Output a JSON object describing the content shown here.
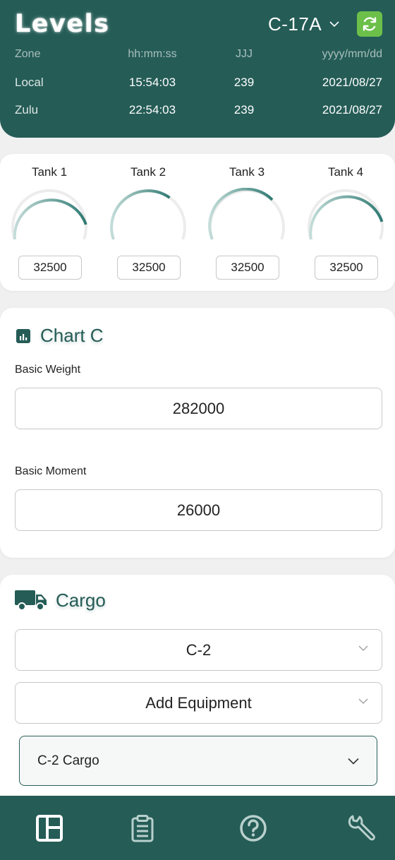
{
  "header": {
    "title": "Levels",
    "aircraft": "C-17A",
    "refresh_icon": "refresh-icon",
    "time_table": {
      "columns": [
        "Zone",
        "hh:mm:ss",
        "JJJ",
        "yyyy/mm/dd"
      ],
      "rows": [
        {
          "zone": "Local",
          "time": "15:54:03",
          "julian": "239",
          "date": "2021/08/27"
        },
        {
          "zone": "Zulu",
          "time": "22:54:03",
          "julian": "239",
          "date": "2021/08/27"
        }
      ]
    }
  },
  "tanks": [
    {
      "label": "Tank 1",
      "value": "32500"
    },
    {
      "label": "Tank 2",
      "value": "32500"
    },
    {
      "label": "Tank 3",
      "value": "32500"
    },
    {
      "label": "Tank 4",
      "value": "32500"
    }
  ],
  "chart_c": {
    "title": "Chart C",
    "basic_weight_label": "Basic Weight",
    "basic_weight": "282000",
    "basic_moment_label": "Basic Moment",
    "basic_moment": "26000"
  },
  "cargo": {
    "title": "Cargo",
    "aircraft_select": "C-2",
    "equipment_select": "Add Equipment",
    "accordion_label": "C-2 Cargo"
  },
  "nav": {
    "items": [
      "dashboard-icon",
      "clipboard-icon",
      "help-icon",
      "wrench-icon"
    ]
  },
  "colors": {
    "primary": "#255c56",
    "accent": "#6cc04a",
    "gauge_dark": "#2f7a72",
    "gauge_light": "#b6d6d1"
  }
}
